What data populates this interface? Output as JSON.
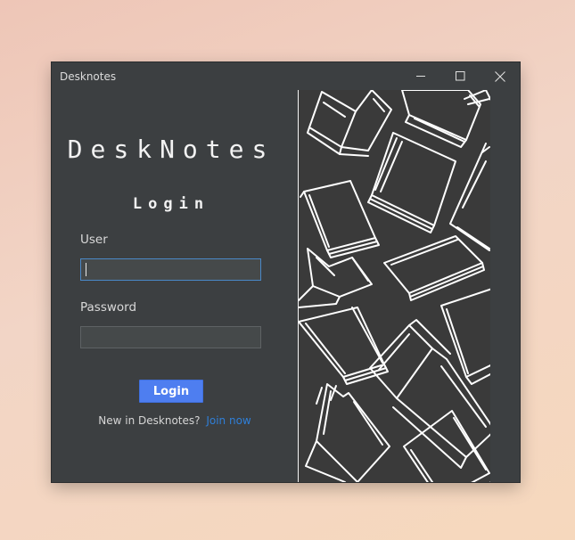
{
  "window": {
    "title": "Desknotes",
    "controls": [
      "minimize-icon",
      "maximize-icon",
      "close-icon"
    ]
  },
  "login_form": {
    "app_title": "DeskNotes",
    "heading": "Login",
    "user_label": "User",
    "user_value": "",
    "password_label": "Password",
    "password_value": "",
    "login_button": "Login",
    "signup_prompt": "New in Desknotes?",
    "join_link": "Join now"
  },
  "illustration": {
    "subject": "books-pattern",
    "background": "#3a3a3a",
    "stroke": "#ffffff"
  },
  "colors": {
    "window_bg": "#3c3f41",
    "accent": "#4e7ef0",
    "link": "#2f7fd8",
    "focus_border": "#4a88c7"
  }
}
